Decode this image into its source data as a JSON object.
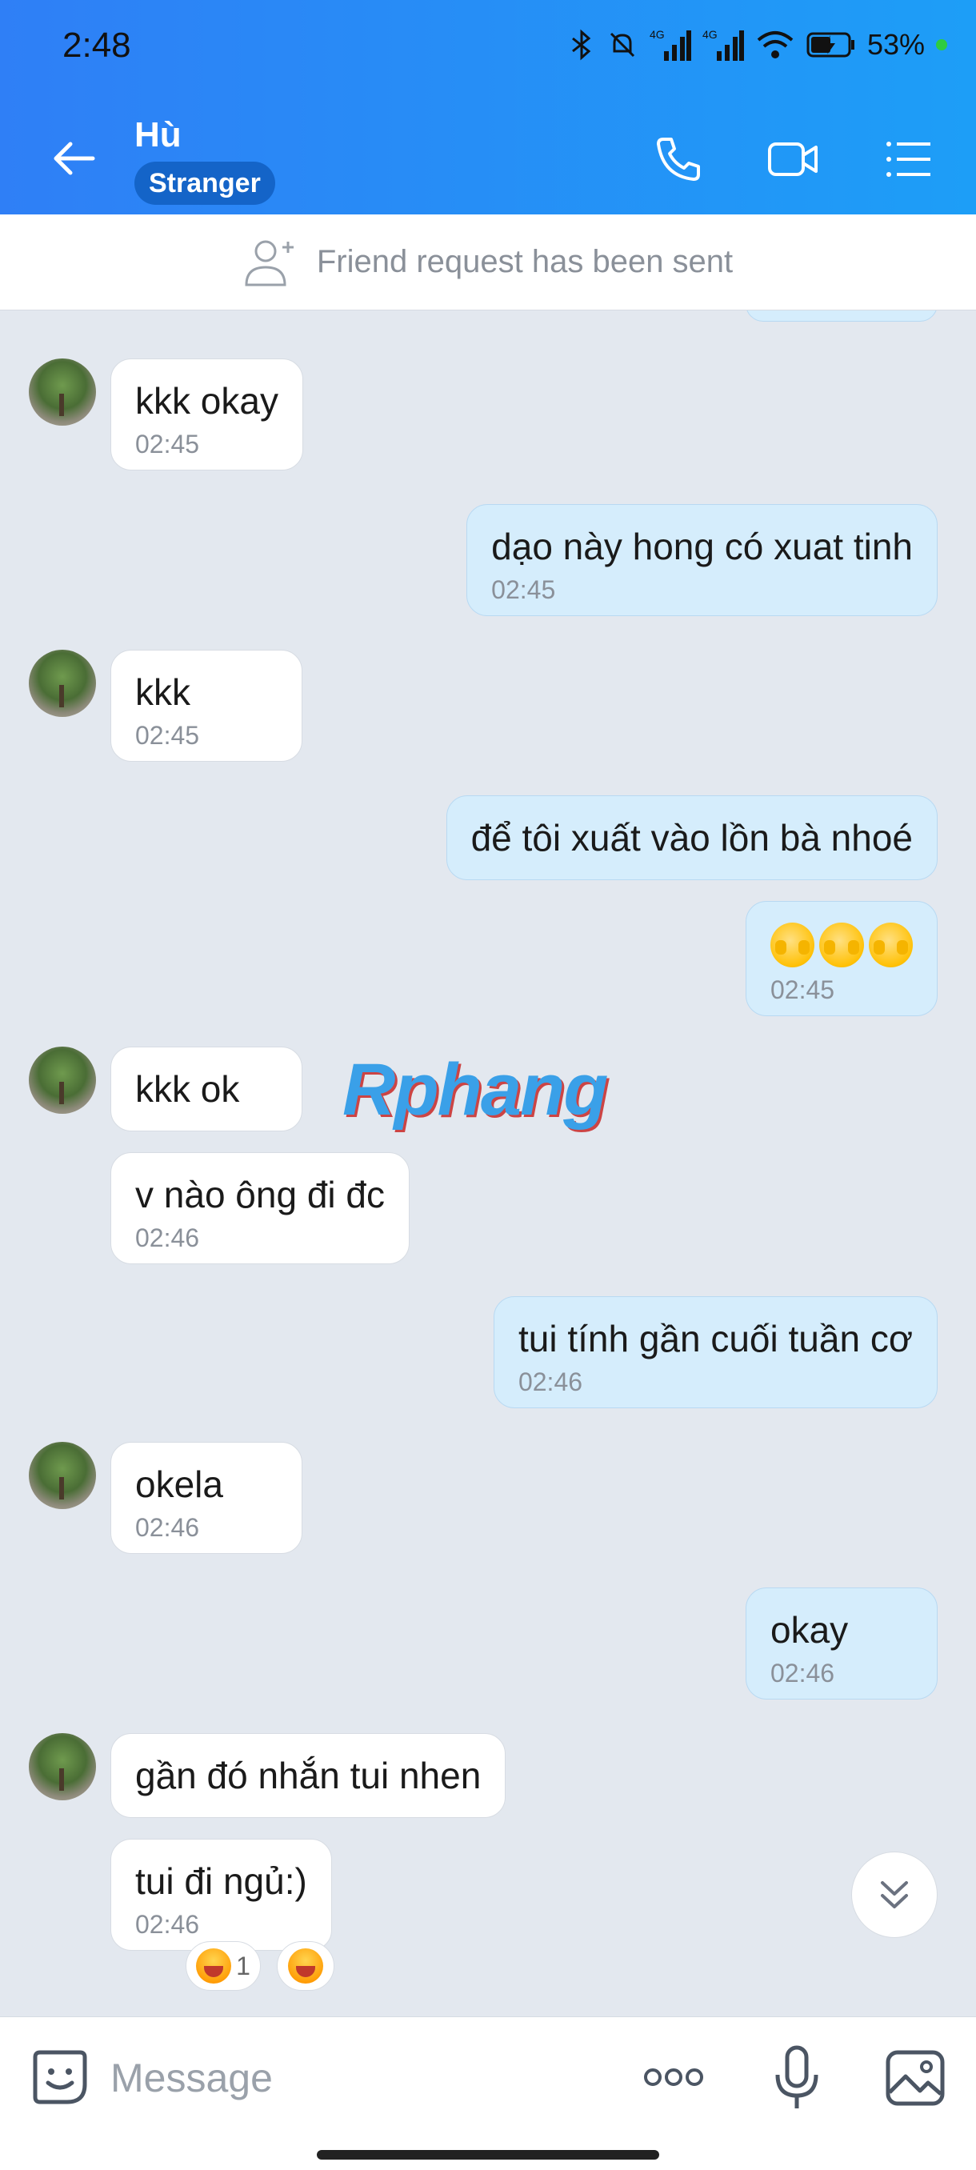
{
  "status_bar": {
    "time": "2:48",
    "battery_percent": "53%",
    "network_1": "4G",
    "network_2": "4G",
    "icons": [
      "bluetooth-icon",
      "mute-icon",
      "signal-icon",
      "signal-icon",
      "wifi-icon",
      "battery-charging-icon"
    ]
  },
  "header": {
    "contact_name": "Hù",
    "badge": "Stranger",
    "back_icon": "arrow-left-icon",
    "actions": [
      "phone-icon",
      "video-icon",
      "menu-icon"
    ],
    "accent_color": "#2f7ff6"
  },
  "friend_request": {
    "text": "Friend request has been sent",
    "icon": "add-user-icon"
  },
  "messages": [
    {
      "side": "in",
      "text": "kkk okay",
      "time": "02:45"
    },
    {
      "side": "out",
      "text": "dạo này hong có xuat tinh",
      "time": "02:45"
    },
    {
      "side": "in",
      "text": "kkk",
      "time": "02:45"
    },
    {
      "side": "out",
      "text": "để tôi xuất vào lồn bà nhoé",
      "time": ""
    },
    {
      "side": "out",
      "text": "🫣🫣🫣",
      "time": "02:45"
    },
    {
      "side": "in",
      "text": "kkk ok",
      "time": ""
    },
    {
      "side": "in",
      "text": "v nào ông đi đc",
      "time": "02:46"
    },
    {
      "side": "out",
      "text": "tui tính gần cuối tuần cơ",
      "time": "02:46"
    },
    {
      "side": "in",
      "text": "okela",
      "time": "02:46"
    },
    {
      "side": "out",
      "text": "okay",
      "time": "02:46"
    },
    {
      "side": "in",
      "text": "gần đó nhắn tui nhen",
      "time": ""
    },
    {
      "side": "in",
      "text": "tui đi ngủ:)",
      "time": "02:46"
    }
  ],
  "reactions": {
    "count": "1"
  },
  "watermark": "Rphang",
  "composer": {
    "placeholder": "Message",
    "icons": [
      "sticker-icon",
      "more-dots-icon",
      "microphone-icon",
      "image-gallery-icon"
    ]
  }
}
